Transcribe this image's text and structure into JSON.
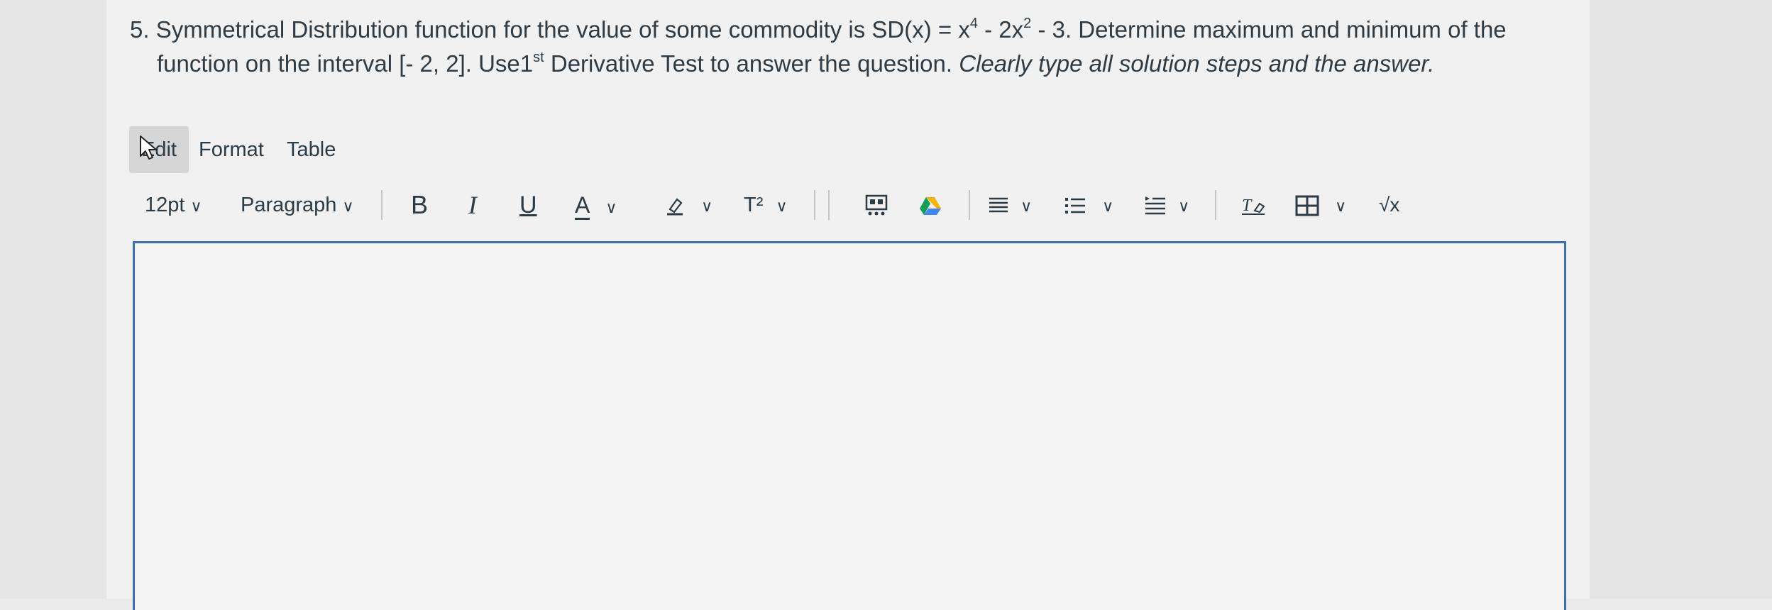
{
  "question": {
    "number": "5.",
    "line1_text": "Symmetrical Distribution function for the value of some commodity is SD(x) = x",
    "exp1": "4",
    "mid1": " - 2x",
    "exp2": "2",
    "line1_end": " - 3. Determine maximum and minimum of the",
    "line2_start": "function on the interval [- 2, 2]. Use1",
    "ordinal": "st",
    "line2_mid": " Derivative Test to answer the question. ",
    "line2_italic": "Clearly type all solution steps and the answer."
  },
  "menubar": {
    "edit": "Edit",
    "format": "Format",
    "table": "Table"
  },
  "toolbar": {
    "font_size": "12pt",
    "block_format": "Paragraph",
    "bold": "B",
    "italic": "I",
    "underline": "U",
    "text_color": "A",
    "superscript": "T²",
    "math": "√x"
  },
  "colors": {
    "editor_border": "#3c6fb4",
    "text": "#2d3b45",
    "drive_yellow": "#f4b400",
    "drive_green": "#0f9d58",
    "drive_blue": "#4285f4"
  }
}
